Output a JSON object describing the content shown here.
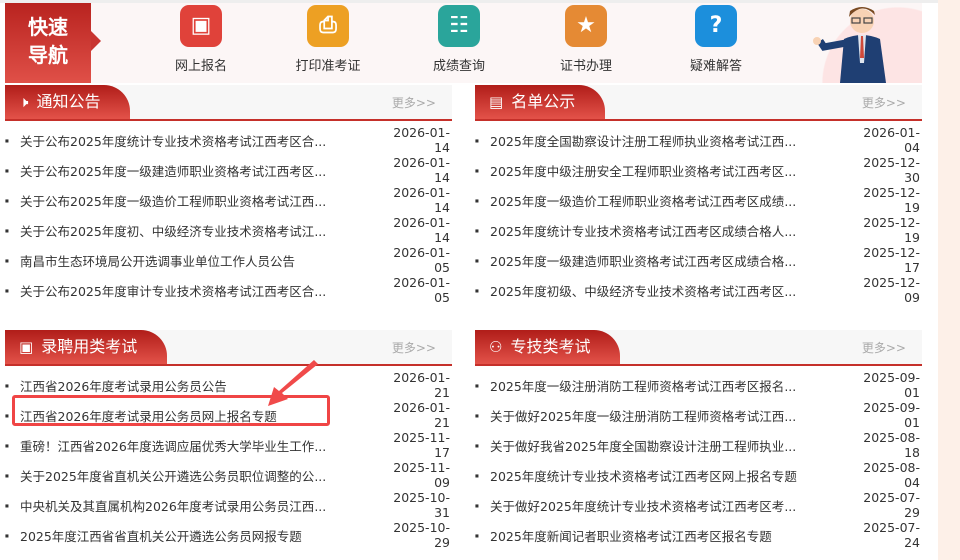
{
  "nav": {
    "title": "快速导航",
    "items": [
      {
        "label": "网上报名",
        "icon": "monitor-icon",
        "color": "#e0423a",
        "glyph": "▣"
      },
      {
        "label": "打印准考证",
        "icon": "printer-icon",
        "color": "#eda023",
        "glyph": "⎙"
      },
      {
        "label": "成绩查询",
        "icon": "score-icon",
        "color": "#2aa59b",
        "glyph": "☷"
      },
      {
        "label": "证书办理",
        "icon": "certificate-icon",
        "color": "#e58a34",
        "glyph": "★"
      },
      {
        "label": "疑难解答",
        "icon": "question-icon",
        "color": "#1c8fdc",
        "glyph": "?"
      }
    ]
  },
  "more": "更多>>",
  "panels": [
    {
      "title": "通知公告",
      "icon": "speaker-icon",
      "rows": [
        [
          "关于公布2025年度统计专业技术资格考试江西考区合...",
          "2026-01-14"
        ],
        [
          "关于公布2025年度一级建造师职业资格考试江西考区...",
          "2026-01-14"
        ],
        [
          "关于公布2025年度一级造价工程师职业资格考试江西...",
          "2026-01-14"
        ],
        [
          "关于公布2025年度初、中级经济专业技术资格考试江...",
          "2026-01-14"
        ],
        [
          "南昌市生态环境局公开选调事业单位工作人员公告",
          "2026-01-05"
        ],
        [
          "关于公布2025年度审计专业技术资格考试江西考区合...",
          "2026-01-05"
        ]
      ]
    },
    {
      "title": "名单公示",
      "icon": "document-icon",
      "rows": [
        [
          "2025年度全国勘察设计注册工程师执业资格考试江西...",
          "2026-01-04"
        ],
        [
          "2025年度中级注册安全工程师职业资格考试江西考区...",
          "2025-12-30"
        ],
        [
          "2025年度一级造价工程师职业资格考试江西考区成绩...",
          "2025-12-19"
        ],
        [
          "2025年度统计专业技术资格考试江西考区成绩合格人...",
          "2025-12-19"
        ],
        [
          "2025年度一级建造师职业资格考试江西考区成绩合格...",
          "2025-12-17"
        ],
        [
          "2025年度初级、中级经济专业技术资格考试江西考区...",
          "2025-12-09"
        ]
      ]
    },
    {
      "title": "录聘用类考试",
      "icon": "exam-icon",
      "rows": [
        [
          "江西省2026年度考试录用公务员公告",
          "2026-01-21"
        ],
        [
          "江西省2026年度考试录用公务员网上报名专题",
          "2026-01-21"
        ],
        [
          "重磅！江西省2026年度选调应届优秀大学毕业生工作...",
          "2025-11-17"
        ],
        [
          "关于2025年度省直机关公开遴选公务员职位调整的公...",
          "2025-11-09"
        ],
        [
          "中央机关及其直属机构2026年度考试录用公务员江西...",
          "2025-10-31"
        ],
        [
          "2025年度江西省省直机关公开遴选公务员网报专题",
          "2025-10-29"
        ]
      ]
    },
    {
      "title": "专技类考试",
      "icon": "user-group-icon",
      "rows": [
        [
          "2025年度一级注册消防工程师资格考试江西考区报名...",
          "2025-09-01"
        ],
        [
          "关于做好2025年度一级注册消防工程师资格考试江西...",
          "2025-09-01"
        ],
        [
          "关于做好我省2025年度全国勘察设计注册工程师执业...",
          "2025-08-18"
        ],
        [
          "2025年度统计专业技术资格考试江西考区网上报名专题",
          "2025-08-04"
        ],
        [
          "关于做好2025年度统计专业技术资格考试江西考区考...",
          "2025-07-29"
        ],
        [
          "2025年度新闻记者职业资格考试江西考区报名专题",
          "2025-07-24"
        ]
      ]
    }
  ]
}
